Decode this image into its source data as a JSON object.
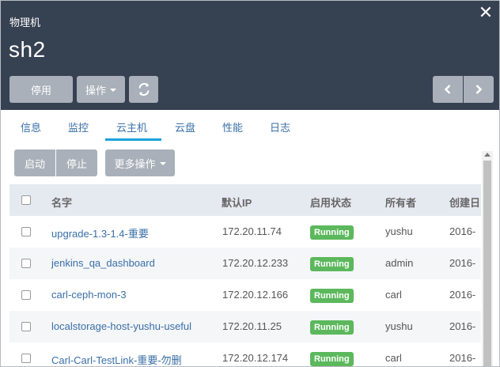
{
  "header": {
    "resource_type": "物理机",
    "resource_name": "sh2",
    "disable_label": "停用",
    "actions_label": "操作",
    "refresh_icon": "refresh-icon",
    "close_icon": "close-icon",
    "prev_icon": "chevron-left-icon",
    "next_icon": "chevron-right-icon"
  },
  "tabs": [
    {
      "label": "信息"
    },
    {
      "label": "监控"
    },
    {
      "label": "云主机"
    },
    {
      "label": "云盘"
    },
    {
      "label": "性能"
    },
    {
      "label": "日志"
    }
  ],
  "active_tab": "云主机",
  "toolbar": {
    "start_label": "启动",
    "stop_label": "停止",
    "more_label": "更多操作"
  },
  "table": {
    "columns": [
      "名字",
      "默认IP",
      "启用状态",
      "所有者",
      "创建日"
    ],
    "rows": [
      {
        "name": "upgrade-1.3-1.4-重要",
        "ip": "172.20.11.74",
        "status": "Running",
        "owner": "yushu",
        "created": "2016-"
      },
      {
        "name": "jenkins_qa_dashboard",
        "ip": "172.20.12.233",
        "status": "Running",
        "owner": "admin",
        "created": "2016-"
      },
      {
        "name": "carl-ceph-mon-3",
        "ip": "172.20.12.166",
        "status": "Running",
        "owner": "carl",
        "created": "2016-"
      },
      {
        "name": "localstorage-host-yushu-useful",
        "ip": "172.20.11.25",
        "status": "Running",
        "owner": "yushu",
        "created": "2016-"
      },
      {
        "name": "Carl-Carl-TestLink-重要-勿删",
        "ip": "172.20.12.174",
        "status": "Running",
        "owner": "carl",
        "created": "2016-"
      }
    ]
  },
  "colors": {
    "header_bg": "#364152",
    "button_bg": "#a9b0b9",
    "link": "#3a6fa8",
    "tab_active": "#1aa1dd",
    "running": "#5cb85c"
  }
}
